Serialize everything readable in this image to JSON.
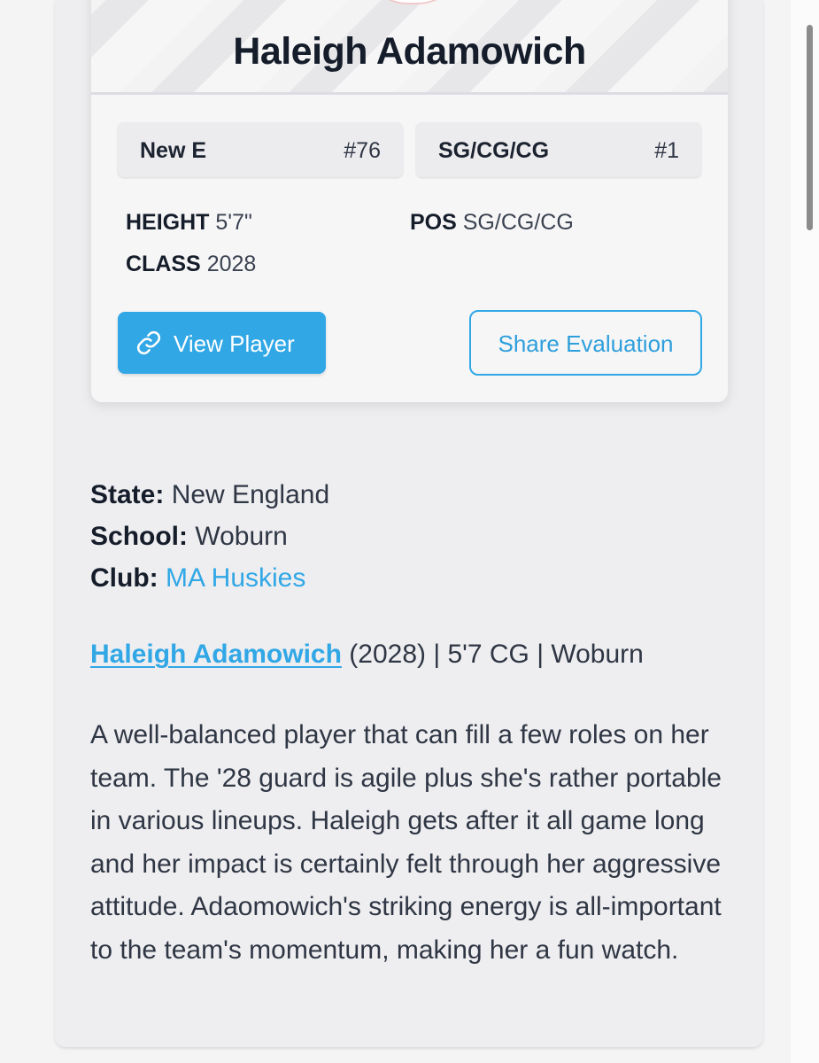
{
  "player": {
    "name": "Haleigh Adamowich"
  },
  "rankings": {
    "state_label": "New E",
    "state_rank": "#76",
    "position_label": "SG/CG/CG",
    "position_rank": "#1"
  },
  "attributes": {
    "height_label": "HEIGHT",
    "height_value": "5'7\"",
    "class_label": "CLASS",
    "class_value": "2028",
    "pos_label": "POS",
    "pos_value": "SG/CG/CG"
  },
  "actions": {
    "view_player_label": "View Player",
    "share_label": "Share Evaluation"
  },
  "details": {
    "state_label": "State:",
    "state_value": "New England",
    "school_label": "School:",
    "school_value": "Woburn",
    "club_label": "Club:",
    "club_value": "MA Huskies"
  },
  "headline": {
    "name_link": "Haleigh Adamowich",
    "rest": " (2028) | 5'7 CG | Woburn"
  },
  "evaluation": {
    "text": "A well-balanced player that can fill a few roles on her team. The '28 guard is agile plus she's rather portable in various lineups. Haleigh gets after it all game long and her impact is certainly felt through her aggressive attitude. Adaomowich's striking energy is all-important to the team's momentum, making her a fun watch."
  },
  "colors": {
    "accent": "#31a7e6",
    "heading": "#151d2b",
    "body": "#2f3644"
  },
  "icons": {
    "view_player": "link-icon"
  }
}
